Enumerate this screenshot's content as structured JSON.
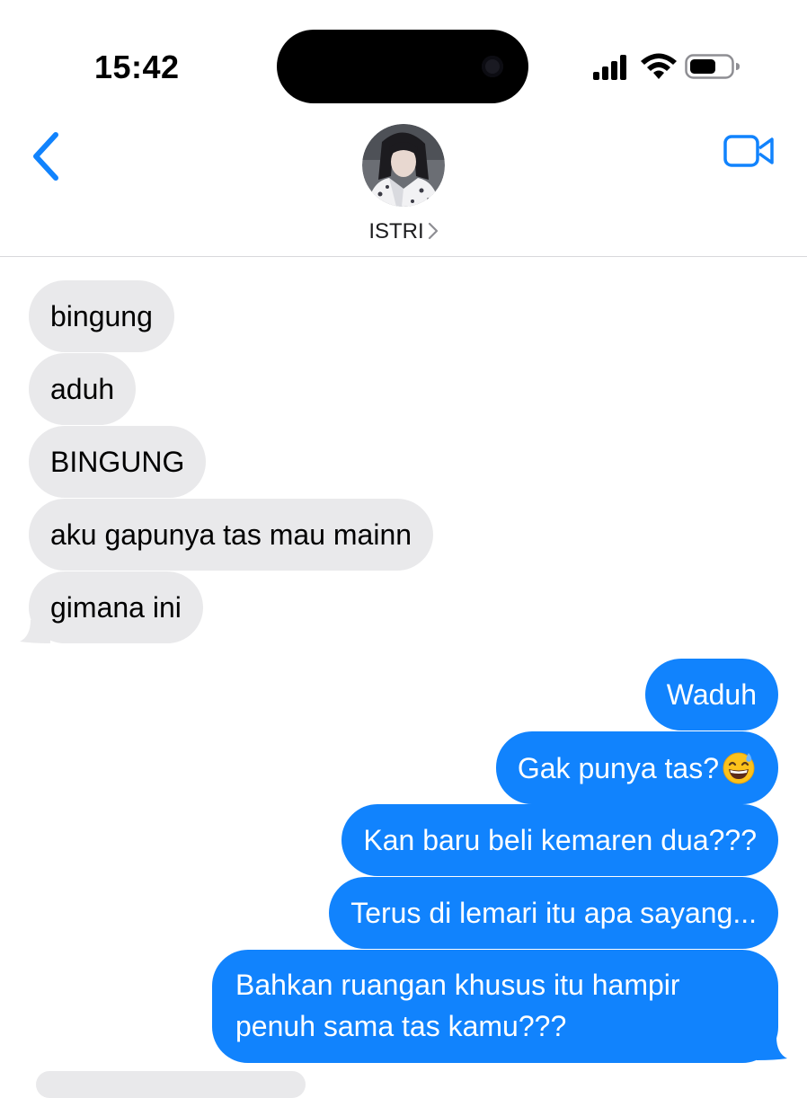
{
  "status_bar": {
    "time": "15:42",
    "signal_icon": "cellular-signal-icon",
    "wifi_icon": "wifi-icon",
    "battery_icon": "battery-icon"
  },
  "header": {
    "back_icon": "chevron-left-icon",
    "contact_name": "ISTRI",
    "contact_chevron_icon": "chevron-right-icon",
    "video_icon": "video-camera-icon"
  },
  "colors": {
    "accent": "#1183fd",
    "incoming_bubble": "#e9e9eb",
    "outgoing_bubble": "#1183fd",
    "separator": "#d8d8dc"
  },
  "messages": [
    {
      "direction": "incoming",
      "text": "bingung"
    },
    {
      "direction": "incoming",
      "text": "aduh"
    },
    {
      "direction": "incoming",
      "text": "BINGUNG"
    },
    {
      "direction": "incoming",
      "text": "aku gapunya tas mau mainn"
    },
    {
      "direction": "incoming",
      "text": "gimana ini"
    },
    {
      "direction": "outgoing",
      "text": "Waduh"
    },
    {
      "direction": "outgoing",
      "text": "Gak punya tas?",
      "emoji": "grinning-face-with-sweat-icon"
    },
    {
      "direction": "outgoing",
      "text": "Kan baru beli kemaren dua???"
    },
    {
      "direction": "outgoing",
      "text": "Terus di lemari itu apa sayang..."
    },
    {
      "direction": "outgoing",
      "text": "Bahkan ruangan khusus itu hampir penuh sama tas kamu???"
    }
  ]
}
